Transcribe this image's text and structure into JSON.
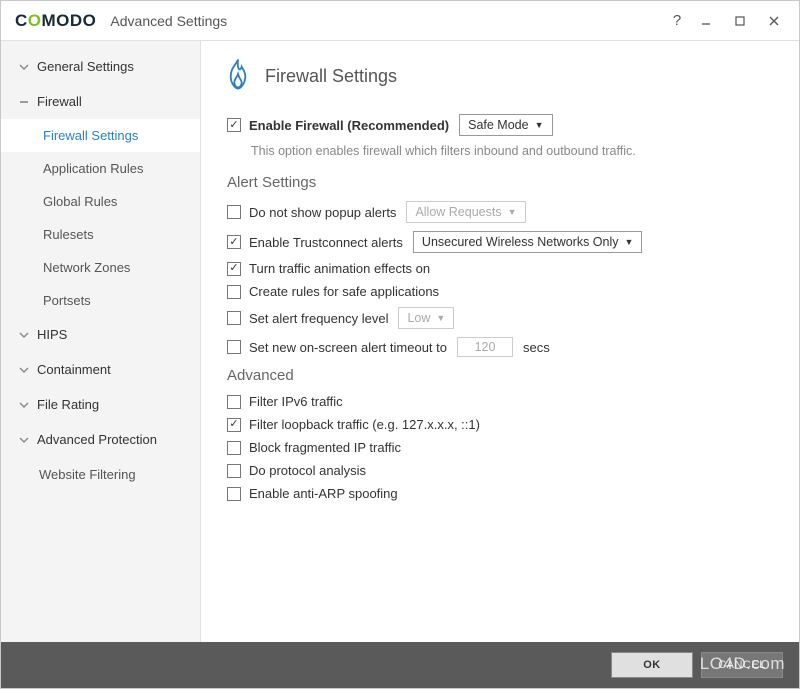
{
  "titlebar": {
    "logo_prefix": "C",
    "logo_green": "O",
    "logo_rest": "MODO",
    "title": "Advanced Settings"
  },
  "sidebar": {
    "groups": [
      {
        "label": "General Settings",
        "expanded": true,
        "sub": []
      },
      {
        "label": "Firewall",
        "expanded": true,
        "current": true,
        "sub": [
          {
            "label": "Firewall Settings",
            "active": true
          },
          {
            "label": "Application Rules"
          },
          {
            "label": "Global Rules"
          },
          {
            "label": "Rulesets"
          },
          {
            "label": "Network Zones"
          },
          {
            "label": "Portsets"
          }
        ]
      },
      {
        "label": "HIPS",
        "expanded": true,
        "sub": []
      },
      {
        "label": "Containment",
        "expanded": true,
        "sub": []
      },
      {
        "label": "File Rating",
        "expanded": true,
        "sub": []
      },
      {
        "label": "Advanced Protection",
        "expanded": true,
        "sub": []
      }
    ],
    "trailing_item": "Website Filtering"
  },
  "main": {
    "page_title": "Firewall Settings",
    "enable_label": "Enable Firewall (Recommended)",
    "enable_checked": true,
    "enable_mode": "Safe Mode",
    "enable_desc": "This option enables firewall which filters inbound and outbound traffic.",
    "alert_section": "Alert Settings",
    "alert_items": {
      "no_popup": {
        "label": "Do not show popup alerts",
        "checked": false,
        "dropdown": "Allow Requests",
        "dropdown_disabled": true
      },
      "trustconnect": {
        "label": "Enable Trustconnect alerts",
        "checked": true,
        "dropdown": "Unsecured Wireless Networks Only"
      },
      "animation": {
        "label": "Turn traffic animation effects on",
        "checked": true
      },
      "safe_rules": {
        "label": "Create rules for safe applications",
        "checked": false
      },
      "alert_freq": {
        "label": "Set alert frequency level",
        "checked": false,
        "dropdown": "Low",
        "dropdown_disabled": true
      },
      "alert_timeout": {
        "label_pre": "Set new on-screen alert timeout to",
        "checked": false,
        "value": "120",
        "unit": "secs"
      }
    },
    "advanced_section": "Advanced",
    "advanced_items": {
      "ipv6": {
        "label": "Filter IPv6 traffic",
        "checked": false
      },
      "loopback": {
        "label": "Filter loopback traffic (e.g. 127.x.x.x, ::1)",
        "checked": true
      },
      "fragmented": {
        "label": "Block fragmented IP traffic",
        "checked": false
      },
      "protocol": {
        "label": "Do protocol analysis",
        "checked": false
      },
      "antiarp": {
        "label": "Enable anti-ARP spoofing",
        "checked": false
      }
    }
  },
  "footer": {
    "ok": "OK",
    "cancel": "CANCEL"
  },
  "watermark": "LO4D.com"
}
